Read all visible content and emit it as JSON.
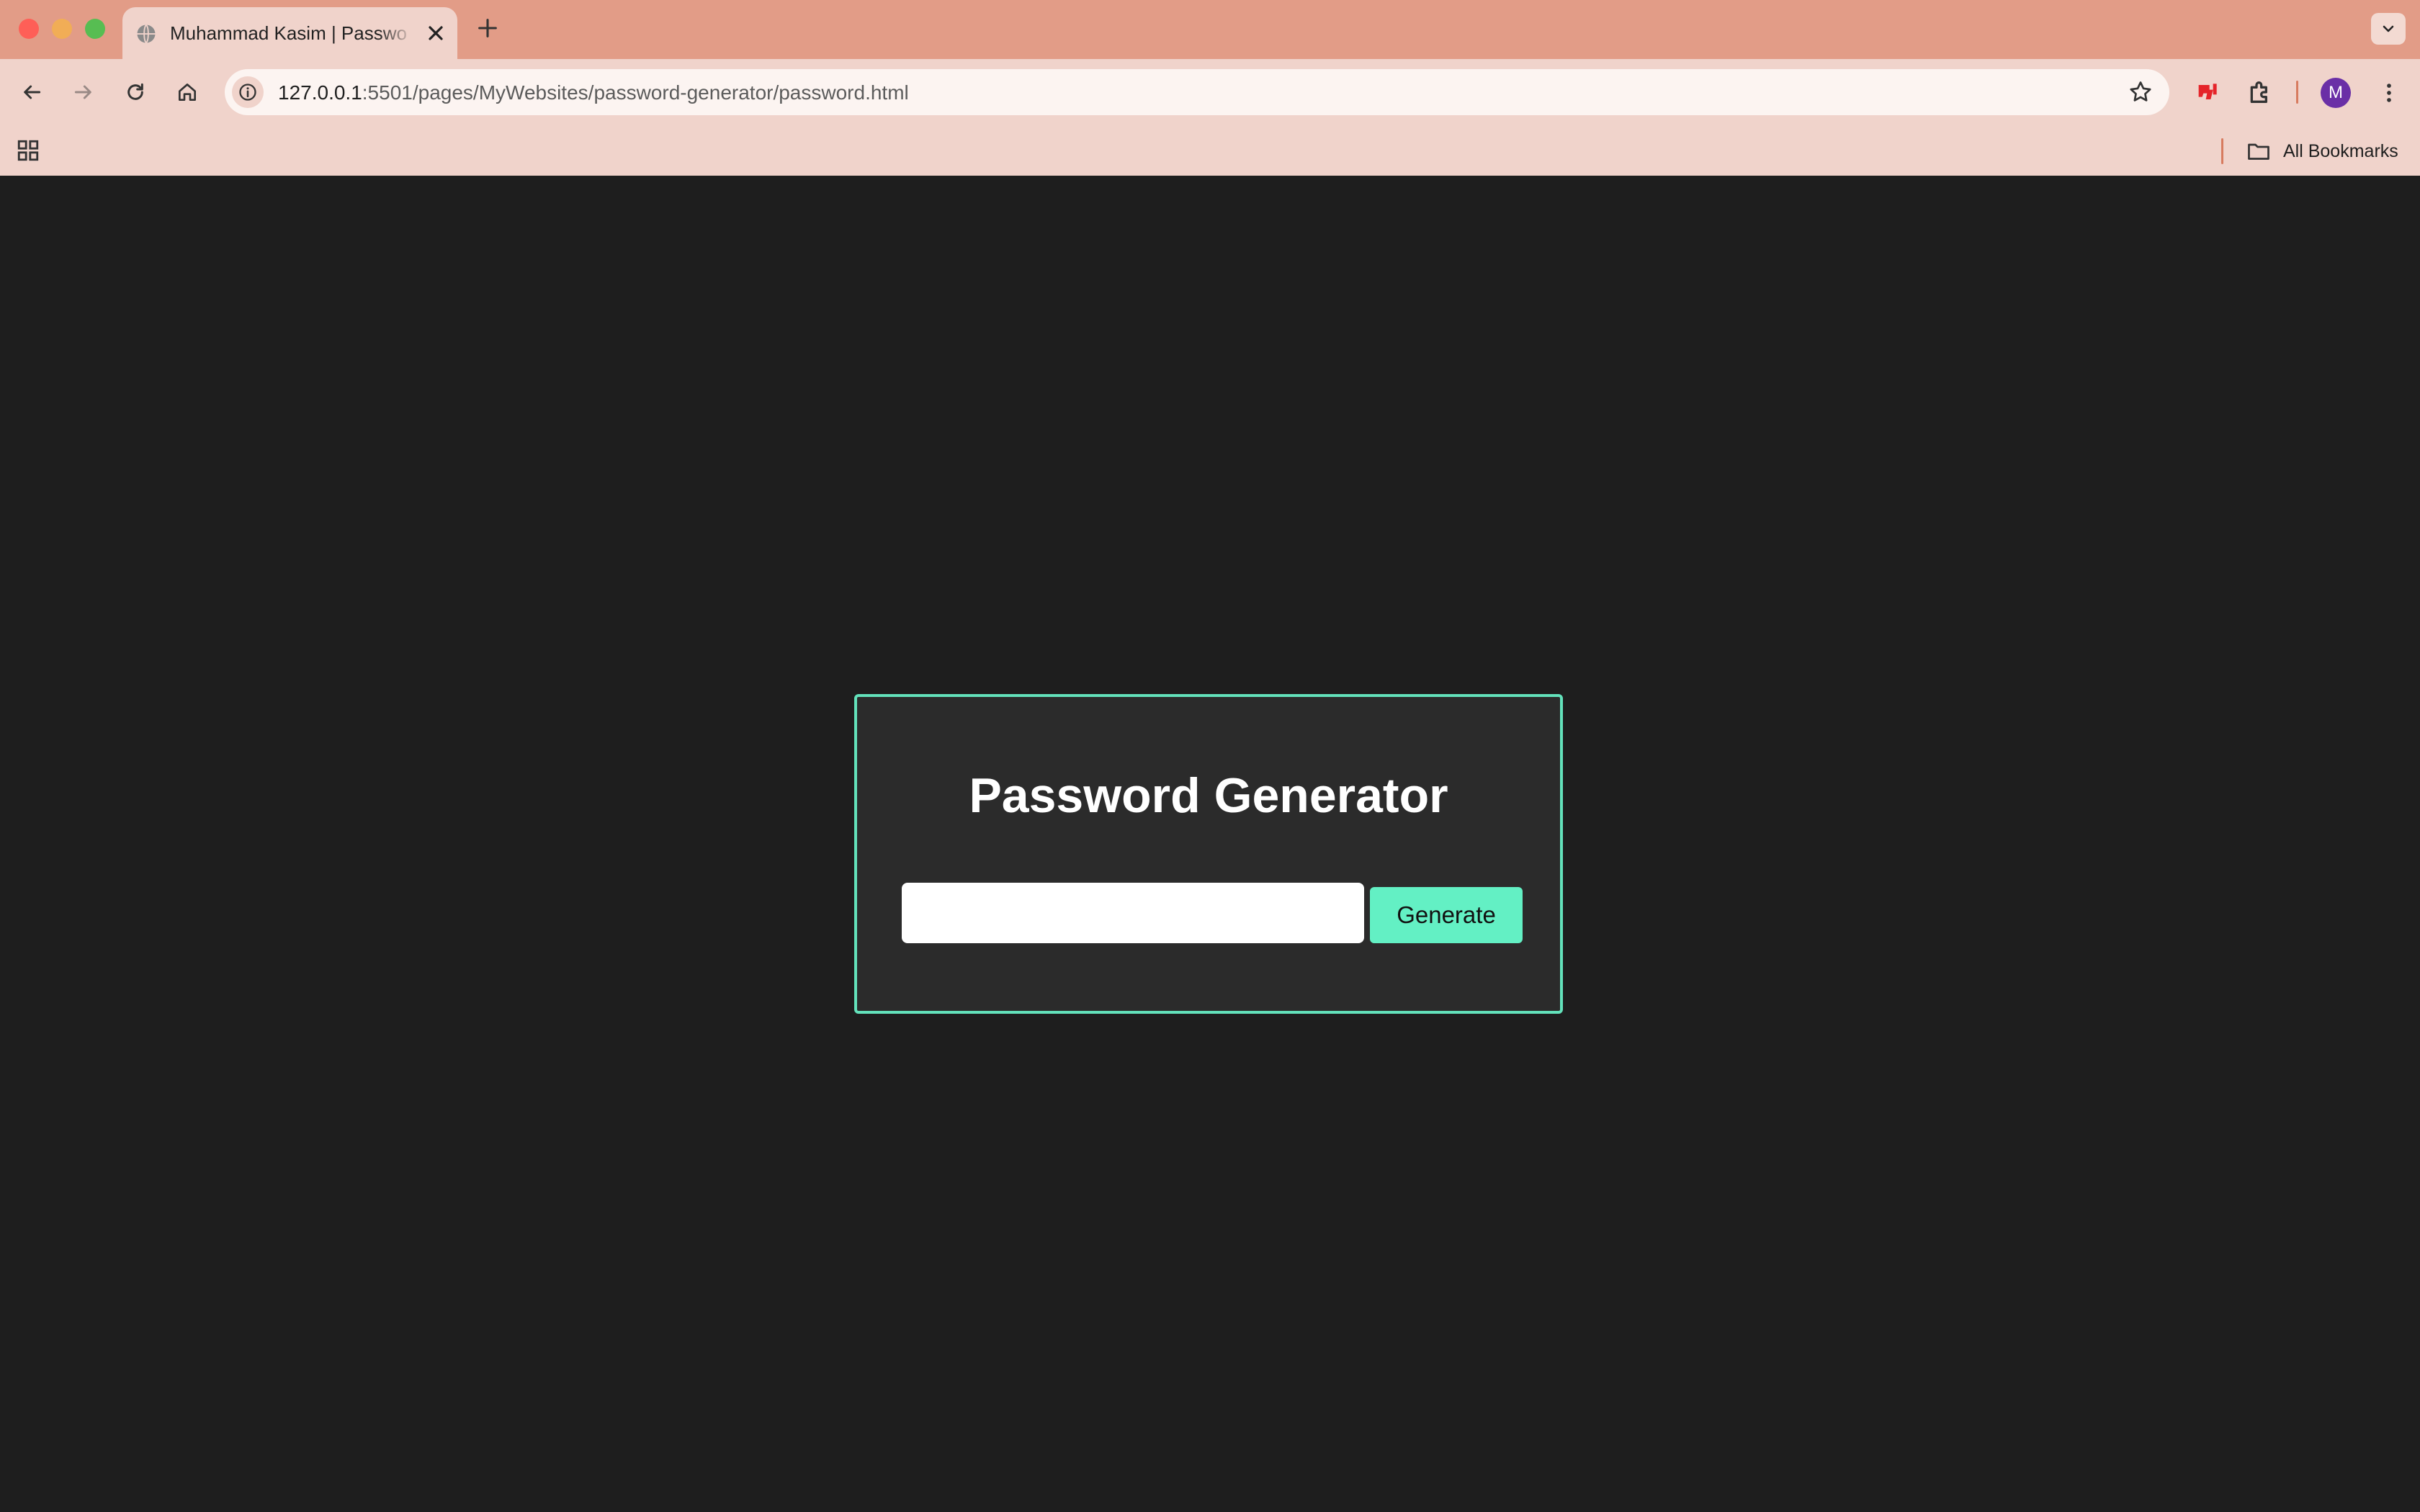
{
  "browser": {
    "tab": {
      "title": "Muhammad Kasim | Password Generator"
    },
    "address_bar": {
      "host": "127.0.0.1",
      "path": ":5501/pages/MyWebsites/password-generator/password.html"
    },
    "profile": {
      "initial": "M"
    },
    "bookmarks_bar": {
      "all_bookmarks_label": "All Bookmarks"
    },
    "icons": [
      "globe-icon",
      "close-icon",
      "plus-icon",
      "chevron-down-icon",
      "back-arrow-icon",
      "forward-arrow-icon",
      "reload-icon",
      "home-icon",
      "info-icon",
      "star-icon",
      "extension-icon",
      "puzzle-icon",
      "more-vert-icon",
      "apps-grid-icon",
      "folder-icon"
    ]
  },
  "page": {
    "heading": "Password Generator",
    "password_input": {
      "value": "",
      "placeholder": ""
    },
    "generate_button": {
      "label": "Generate"
    },
    "colors": {
      "background": "#1e1e1e",
      "card": "#2b2b2b",
      "accent": "#63e2bb",
      "button": "#63f0c4"
    }
  }
}
